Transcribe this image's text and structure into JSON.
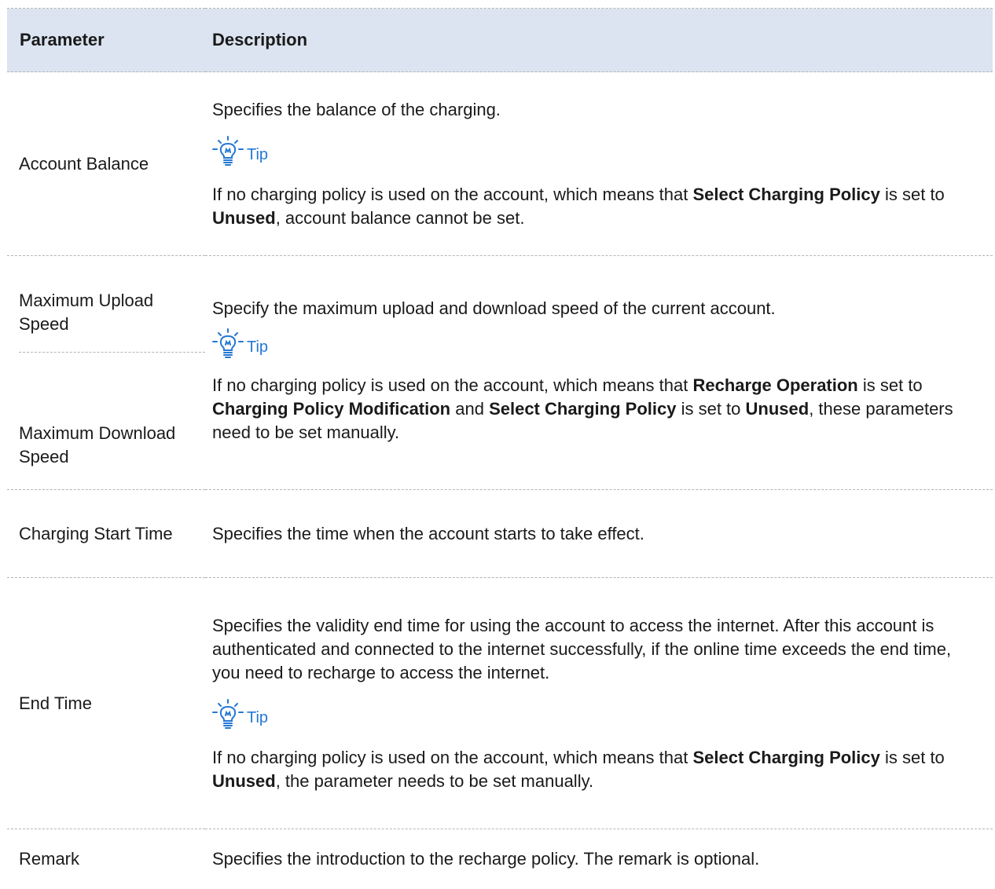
{
  "table": {
    "headers": {
      "parameter": "Parameter",
      "description": "Description"
    },
    "tip_label": "Tip",
    "rows": {
      "account_balance": {
        "parameter": "Account Balance",
        "desc1": "Specifies the balance of the charging.",
        "tip_text": [
          "If no charging policy is used on the account, which means that ",
          "Select Charging Policy",
          " is set to ",
          "Unused",
          ", account balance cannot be set."
        ]
      },
      "speed": {
        "param_upload": "Maximum Upload Speed",
        "param_download": "Maximum Download Speed",
        "desc1": "Specify the maximum upload and download speed of the current account.",
        "tip_text": [
          "If no charging policy is used on the account, which means that ",
          "Recharge Operation",
          " is set to ",
          "Charging Policy Modification",
          " and ",
          "Select Charging Policy",
          " is set to ",
          "Unused",
          ", these parameters need to be set manually."
        ]
      },
      "charging_start": {
        "parameter": "Charging Start Time",
        "desc1": "Specifies the time when the account starts to take effect."
      },
      "end_time": {
        "parameter": "End Time",
        "desc1": "Specifies the validity end time for using the account to access the internet. After this account is authenticated and connected to the internet successfully, if the online time exceeds the end time, you need to recharge to access the internet.",
        "tip_text": [
          "If no charging policy is used on the account, which means that ",
          "Select Charging Policy",
          " is set to ",
          "Unused",
          ", the parameter needs to be set manually."
        ]
      },
      "remark": {
        "parameter": "Remark",
        "desc1": "Specifies the introduction to the recharge policy. The remark is optional."
      }
    }
  },
  "colors": {
    "header_bg": "#dbe4f0",
    "tip": "#2478d4",
    "border": "#b5b5b5"
  },
  "icons": {
    "tip": "lightbulb-icon"
  }
}
